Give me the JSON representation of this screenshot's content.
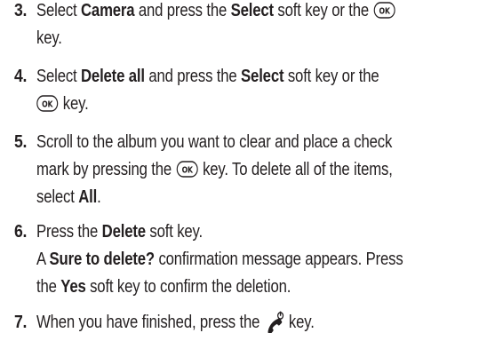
{
  "steps": [
    {
      "number": "3.",
      "line1_a": "Select ",
      "line1_b": "Camera",
      "line1_c": " and press the ",
      "line1_d": "Select",
      "line1_e": " soft key or the ",
      "line2": "key.",
      "ok_icon_label": "OK"
    },
    {
      "number": "4.",
      "line1_a": "Select ",
      "line1_b": "Delete all",
      "line1_c": " and press the ",
      "line1_d": "Select",
      "line1_e": " soft key or the",
      "line2_after_icon": " key.",
      "ok_icon_label": "OK"
    },
    {
      "number": "5.",
      "line1": "Scroll to the album you want to clear and place a check",
      "line2_a": "mark by pressing the ",
      "line2_b": " key. To delete all of the items,",
      "line3_a": "select ",
      "line3_b": "All",
      "line3_c": ".",
      "ok_icon_label": "OK"
    },
    {
      "number": "6.",
      "line1_a": "Press the ",
      "line1_b": "Delete",
      "line1_c": " soft key.",
      "line2_a": "A ",
      "line2_b": "Sure to delete?",
      "line2_c": " confirmation message appears. Press",
      "line3_a": "the ",
      "line3_b": "Yes",
      "line3_c": " soft key to confirm the deletion."
    },
    {
      "number": "7.",
      "line1_a": "When you have finished, press the",
      "line1_b": "key."
    }
  ],
  "icons": {
    "ok_key": "ok-key-icon",
    "end_key": "end-power-key-icon"
  },
  "colors": {
    "text": "#231f20"
  }
}
